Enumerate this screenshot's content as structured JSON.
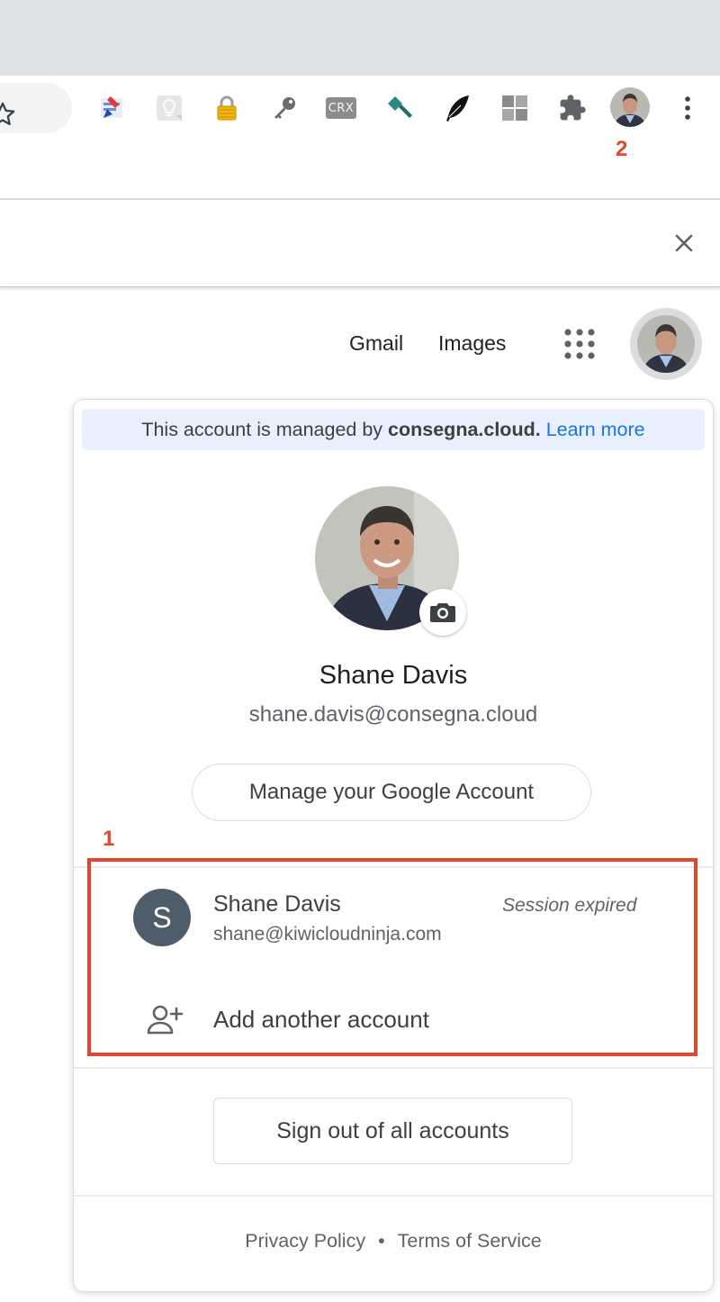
{
  "browser": {
    "extensions": [
      {
        "name": "bookmark-extension-icon"
      },
      {
        "name": "lightbulb-extension-icon"
      },
      {
        "name": "lock-extension-icon"
      },
      {
        "name": "key-extension-icon"
      },
      {
        "name": "crx-extension-icon",
        "label": "CRX"
      },
      {
        "name": "hammer-extension-icon"
      },
      {
        "name": "quill-extension-icon"
      },
      {
        "name": "windows-extension-icon"
      },
      {
        "name": "puzzle-extensions-icon"
      }
    ],
    "annotation_profile": "2"
  },
  "google_bar": {
    "gmail": "Gmail",
    "images": "Images"
  },
  "account_panel": {
    "managed_prefix": "This account is managed by",
    "managed_domain": "consegna.cloud.",
    "learn_more": "Learn more",
    "name": "Shane Davis",
    "email": "shane.davis@consegna.cloud",
    "manage_button": "Manage your Google Account",
    "annotation_accounts": "1",
    "other_account": {
      "initial": "S",
      "name": "Shane Davis",
      "email": "shane@kiwicloudninja.com",
      "status": "Session expired"
    },
    "add_account": "Add another account",
    "sign_out": "Sign out of all accounts",
    "footer": {
      "privacy": "Privacy Policy",
      "separator": "•",
      "terms": "Terms of Service"
    }
  },
  "colors": {
    "accent_link": "#1a73e8",
    "annotation_red": "#e8442a",
    "managed_banner": "#e8f0fe"
  }
}
